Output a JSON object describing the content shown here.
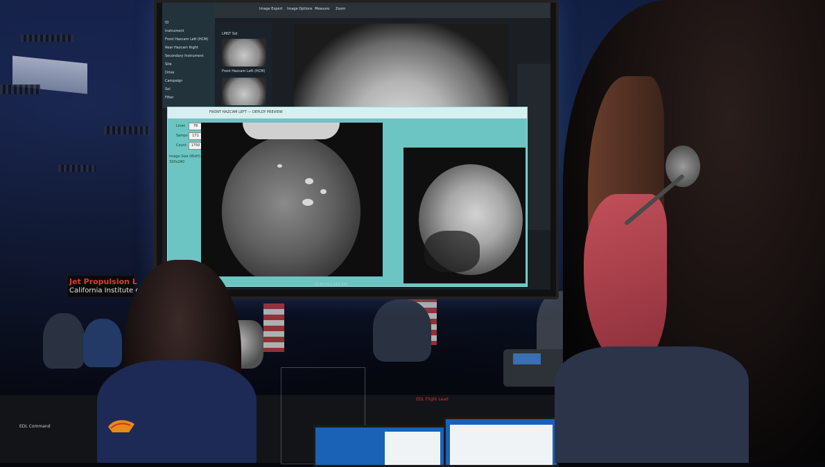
{
  "monitor": {
    "toolbar_items": [
      "Image Export",
      "Image Options",
      "Measure",
      "Zoom"
    ],
    "left_panel_rows": [
      "ID",
      "Instrument",
      "Front Hazcam Left (HCM)",
      "Rear Hazcam Right",
      "Secondary Instrument",
      "Site",
      "Drive",
      "Campaign",
      "Sol",
      "Filter"
    ],
    "thumb_labels": [
      "LMST Sol",
      "Front Hazcam Left (HCM)"
    ],
    "dialog_title": "FRONT HAZCAM LEFT — DEPLOY PREVIEW",
    "fields": [
      {
        "label": "Lines",
        "value": "78"
      },
      {
        "label": "Samps",
        "value": "171"
      },
      {
        "label": "Count",
        "value": "1750"
      }
    ],
    "image_size_label": "Image Size (WxH):",
    "image_size_value": "320x240",
    "bottom_toolbar": "LS 83,811,163,333"
  },
  "sign": {
    "line1": "Jet Propulsion L",
    "line2": "California Institute o"
  },
  "desk": {
    "label": "EDL Flight Lead",
    "ledger": "EDL Command"
  },
  "colors": {
    "dialog": "#6cc5c2",
    "mask": "#c2505a",
    "sign_red": "#e03a2a",
    "small_monitor": "#1a62b6"
  }
}
